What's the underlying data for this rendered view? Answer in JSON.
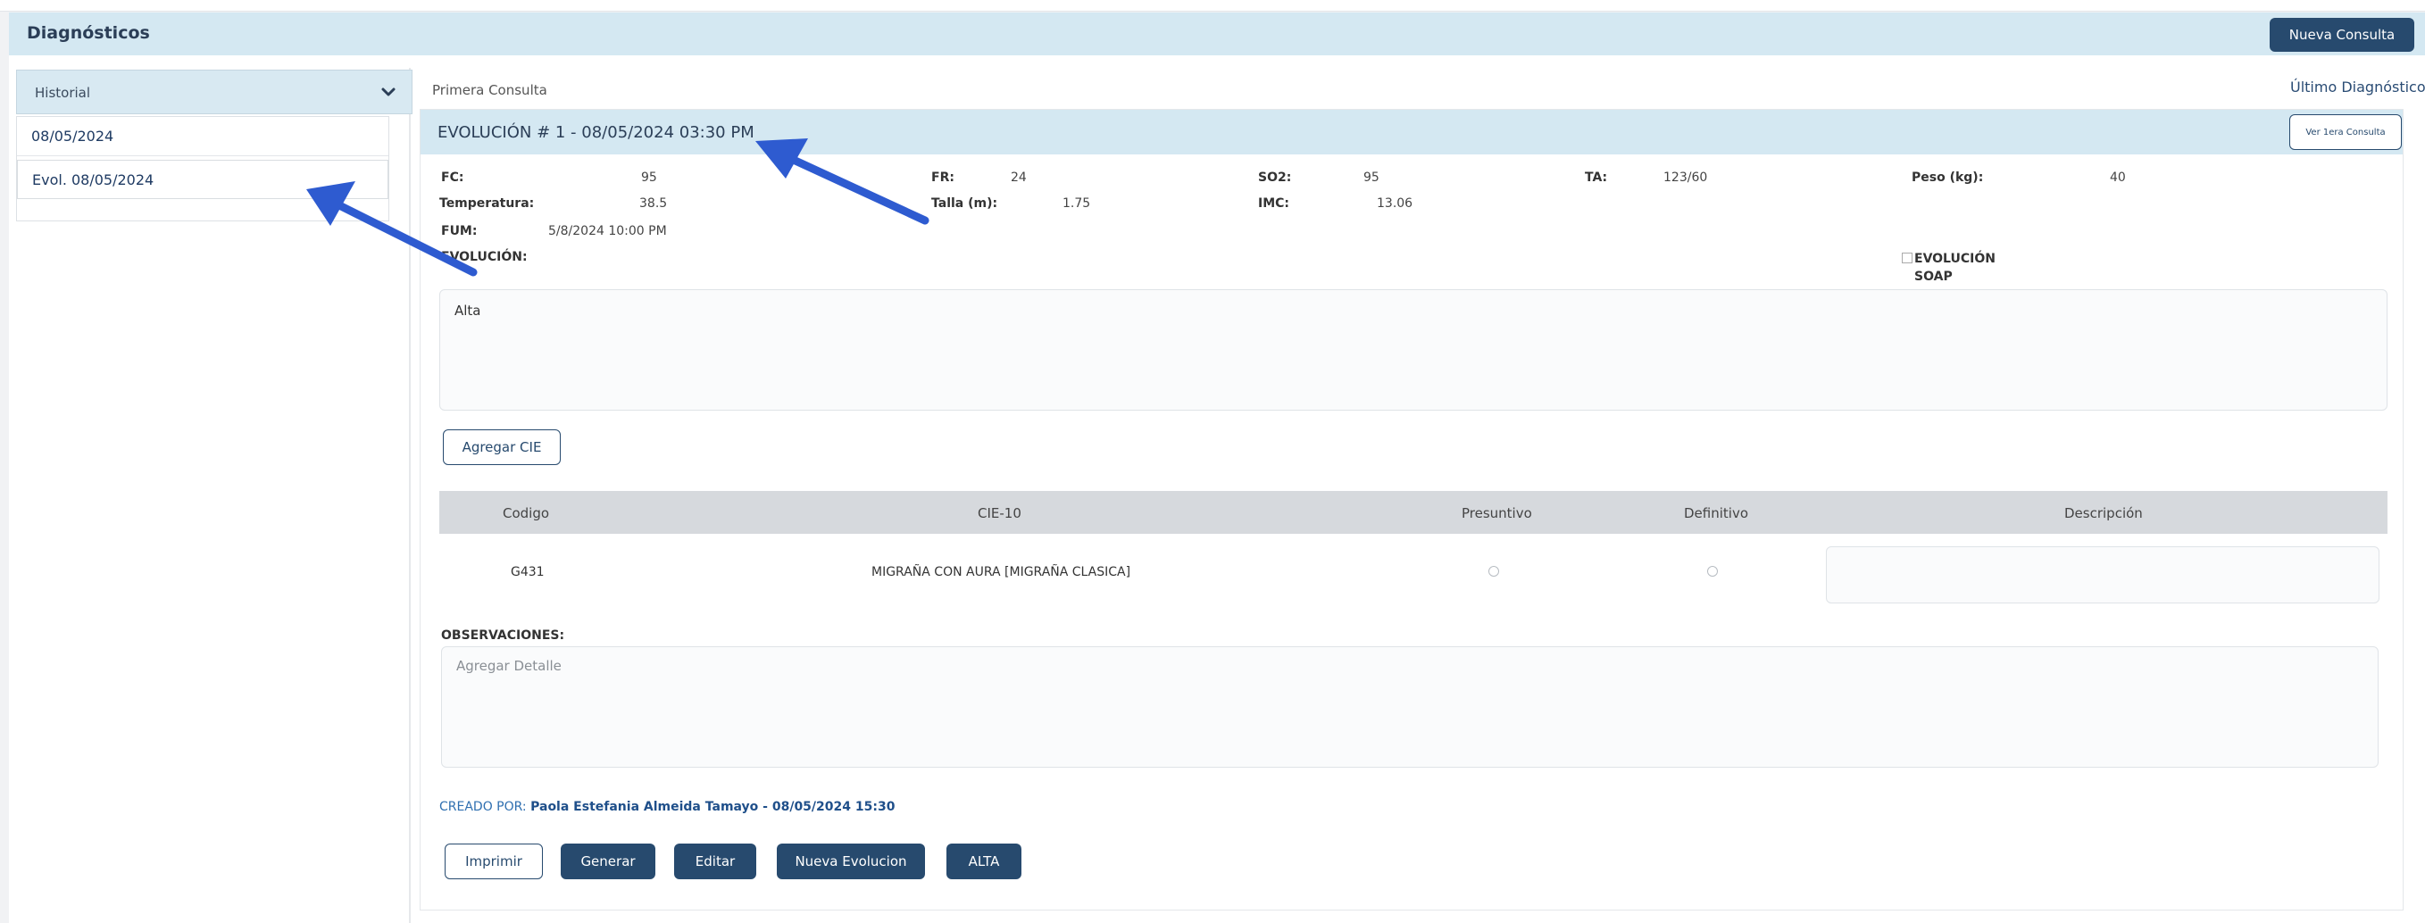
{
  "header": {
    "title": "Diagnósticos",
    "nueva_consulta": "Nueva Consulta"
  },
  "sidebar": {
    "dropdown_label": "Historial",
    "items": [
      {
        "label": "08/05/2024"
      },
      {
        "label": "Evol. 08/05/2024"
      }
    ]
  },
  "main": {
    "primera_consulta": "Primera Consulta",
    "ultimo_diagnostico": "Último Diagnóstico -",
    "card_title": "EVOLUCIÓN # 1 - 08/05/2024 03:30 PM",
    "ver_button": "Ver 1era Consulta",
    "vitals": {
      "fc_label": "FC:",
      "fc_value": "95",
      "fr_label": "FR:",
      "fr_value": "24",
      "so2_label": "SO2:",
      "so2_value": "95",
      "ta_label": "TA:",
      "ta_value": "123/60",
      "peso_label": "Peso (kg):",
      "peso_value": "40",
      "temp_label": "Temperatura:",
      "temp_value": "38.5",
      "talla_label": "Talla (m):",
      "talla_value": "1.75",
      "imc_label": "IMC:",
      "imc_value": "13.06",
      "fum_label": "FUM:",
      "fum_value": "5/8/2024 10:00 PM"
    },
    "evolucion_label": "EVOLUCIÓN:",
    "soap_label": "EVOLUCIÓN SOAP",
    "evolucion_text": "Alta",
    "agregar_cie": "Agregar CIE",
    "table": {
      "headers": [
        "Codigo",
        "CIE-10",
        "Presuntivo",
        "Definitivo",
        "Descripción"
      ],
      "row": {
        "codigo": "G431",
        "cie": "MIGRAÑA CON AURA [MIGRAÑA CLASICA]"
      }
    },
    "observaciones_label": "OBSERVACIONES:",
    "observaciones_placeholder": "Agregar Detalle",
    "creado_prefix": "CREADO POR:",
    "creado_by": "Paola Estefania Almeida Tamayo - 08/05/2024 15:30",
    "buttons": {
      "imprimir": "Imprimir",
      "generar": "Generar",
      "editar": "Editar",
      "nueva_evolucion": "Nueva Evolucion",
      "alta": "ALTA"
    }
  },
  "colors": {
    "accent": "#274a6e",
    "header_bg": "#d4e8f2",
    "annotation_arrow": "#2e5bd0"
  },
  "icons": [
    "chevron-down-icon",
    "arrow-annotation-icon"
  ]
}
